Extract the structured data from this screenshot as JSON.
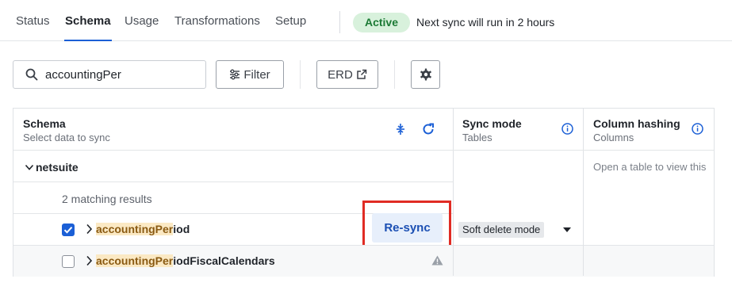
{
  "tabs": [
    {
      "label": "Status"
    },
    {
      "label": "Schema"
    },
    {
      "label": "Usage"
    },
    {
      "label": "Transformations"
    },
    {
      "label": "Setup"
    }
  ],
  "active_tab": "Schema",
  "status_badge": "Active",
  "sync_note": "Next sync will run in 2 hours",
  "toolbar": {
    "search_value": "accountingPer",
    "filter_label": "Filter",
    "erd_label": "ERD"
  },
  "table": {
    "columns": [
      {
        "title": "Schema",
        "subtitle": "Select data to sync"
      },
      {
        "title": "Sync mode",
        "subtitle": "Tables"
      },
      {
        "title": "Column hashing",
        "subtitle": "Columns"
      }
    ],
    "column_hashing_hint": "Open a table to view this",
    "schema_name": "netsuite",
    "match_text": "2 matching results",
    "rows": [
      {
        "name_match": "accountingPer",
        "name_rest": "iod",
        "checked": true,
        "sync_mode": "Soft delete mode",
        "action": "Re-sync"
      },
      {
        "name_match": "accountingPer",
        "name_rest": "iodFiscalCalendars",
        "checked": false,
        "warning": true
      }
    ]
  },
  "colors": {
    "accent": "#1b5fd6",
    "active_badge_bg": "#d8f1dc",
    "active_badge_text": "#1c7a35",
    "highlight_bg": "#fbe9c4",
    "annotation_red": "#e02b24"
  }
}
